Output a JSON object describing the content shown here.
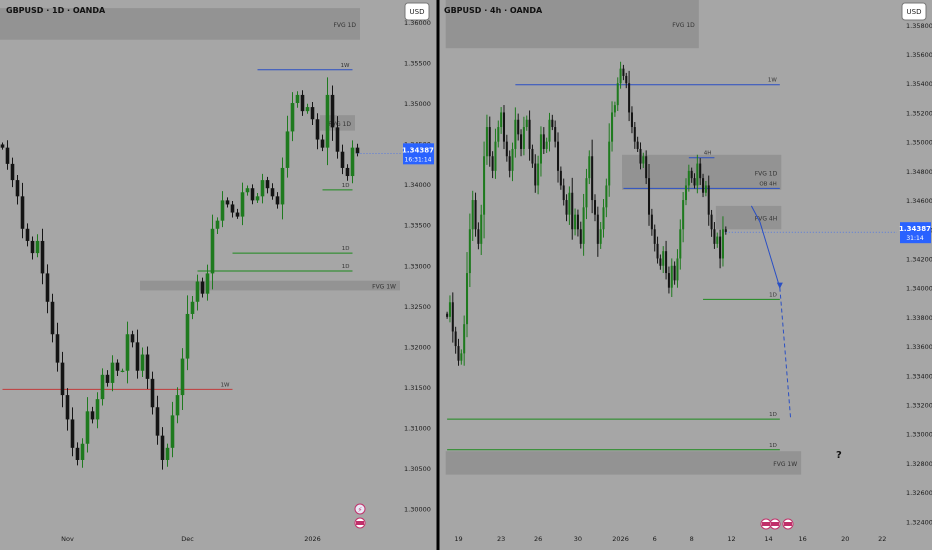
{
  "colors": {
    "background": "#a6a6a6",
    "bull": "#1e7a1e",
    "bear": "#141414",
    "zone": "#8c8c8c",
    "level_blue": "#2a4fc4",
    "level_green": "#1c8a1c",
    "level_red": "#c23b3b",
    "price_tag": "#2962ff",
    "divider": "#000000"
  },
  "chart_data": [
    {
      "type": "candlestick",
      "title": "GBPUSD · 1D · OANDA",
      "currency_button": "USD",
      "ylim": [
        1.297,
        1.3627
      ],
      "y_ticks": [
        "1.36000",
        "1.35500",
        "1.35000",
        "1.34500",
        "1.34000",
        "1.33500",
        "1.33000",
        "1.32500",
        "1.32000",
        "1.31500",
        "1.31000",
        "1.30500",
        "1.30000"
      ],
      "y_tick_values": [
        1.36,
        1.355,
        1.35,
        1.345,
        1.34,
        1.335,
        1.33,
        1.325,
        1.32,
        1.315,
        1.31,
        1.305,
        1.3
      ],
      "x_labels": [
        "Nov",
        "Dec",
        "2026"
      ],
      "x_label_bars": [
        13,
        37,
        62
      ],
      "last_price": "1.34387",
      "countdown": "16:31:14",
      "bar_count": 72,
      "closes": [
        1.3445,
        1.3425,
        1.3405,
        1.3385,
        1.3345,
        1.333,
        1.3315,
        1.333,
        1.329,
        1.3255,
        1.3215,
        1.318,
        1.314,
        1.311,
        1.3075,
        1.306,
        1.308,
        1.312,
        1.311,
        1.3135,
        1.3165,
        1.3155,
        1.318,
        1.317,
        1.317,
        1.3215,
        1.3205,
        1.317,
        1.319,
        1.316,
        1.3125,
        1.309,
        1.306,
        1.3075,
        1.3115,
        1.314,
        1.3185,
        1.324,
        1.3255,
        1.328,
        1.3265,
        1.329,
        1.3345,
        1.3355,
        1.338,
        1.3375,
        1.3365,
        1.336,
        1.339,
        1.3395,
        1.338,
        1.3385,
        1.3405,
        1.3395,
        1.3385,
        1.3375,
        1.342,
        1.3465,
        1.35,
        1.351,
        1.349,
        1.3495,
        1.348,
        1.3455,
        1.3445,
        1.351,
        1.347,
        1.344,
        1.342,
        1.341,
        1.3445,
        1.3438
      ],
      "zones": [
        {
          "label": "FVG 1D",
          "y_top": 1.3617,
          "y_bottom": 1.3578,
          "x_from": 0,
          "x_to": 71
        },
        {
          "label": "FVG 1D",
          "y_top": 1.3485,
          "y_bottom": 1.3466,
          "x_from": 64,
          "x_to": 70
        },
        {
          "label": "FVG 1W",
          "y_top": 1.3281,
          "y_bottom": 1.3269,
          "x_from": 28,
          "x_to": 80
        }
      ],
      "levels": [
        {
          "label": "1W",
          "value": 1.3541,
          "x_from": 51,
          "x_to": 70,
          "color": "level_blue"
        },
        {
          "label": "1D",
          "value": 1.3393,
          "x_from": 64,
          "x_to": 70,
          "color": "level_green"
        },
        {
          "label": "1D",
          "value": 1.3315,
          "x_from": 46,
          "x_to": 70,
          "color": "level_green"
        },
        {
          "label": "1D",
          "value": 1.3293,
          "x_from": 39,
          "x_to": 70,
          "color": "level_green"
        },
        {
          "label": "1W",
          "value": 1.3147,
          "x_from": 0,
          "x_to": 46,
          "color": "level_red"
        }
      ]
    },
    {
      "type": "candlestick",
      "title": "GBPUSD · 4h · OANDA",
      "currency_button": "USD",
      "ylim": [
        1.3232,
        1.3597
      ],
      "y_ticks": [
        "1.35800",
        "1.35600",
        "1.35400",
        "1.35200",
        "1.35000",
        "1.34800",
        "1.34600",
        "1.34400",
        "1.34200",
        "1.34000",
        "1.33800",
        "1.33600",
        "1.33400",
        "1.33200",
        "1.33000",
        "1.32800",
        "1.32600",
        "1.32400"
      ],
      "y_tick_values": [
        1.358,
        1.356,
        1.354,
        1.352,
        1.35,
        1.348,
        1.346,
        1.344,
        1.342,
        1.34,
        1.338,
        1.336,
        1.334,
        1.332,
        1.33,
        1.328,
        1.326,
        1.324
      ],
      "x_labels": [
        "19",
        "23",
        "26",
        "30",
        "2026",
        "6",
        "8",
        "12",
        "14",
        "16",
        "20",
        "22"
      ],
      "x_label_bars": [
        4,
        19,
        32,
        46,
        61,
        73,
        86,
        100,
        113,
        125,
        140,
        153
      ],
      "last_price": "1.34387",
      "countdown": "31:14",
      "bar_count": 120,
      "closes": [
        1.338,
        1.339,
        1.337,
        1.336,
        1.335,
        1.3355,
        1.3375,
        1.341,
        1.344,
        1.346,
        1.344,
        1.343,
        1.345,
        1.349,
        1.351,
        1.349,
        1.348,
        1.35,
        1.351,
        1.352,
        1.35,
        1.349,
        1.348,
        1.3495,
        1.3515,
        1.3505,
        1.3495,
        1.351,
        1.3515,
        1.3495,
        1.3485,
        1.347,
        1.3485,
        1.3505,
        1.3495,
        1.35,
        1.3515,
        1.351,
        1.35,
        1.348,
        1.347,
        1.346,
        1.345,
        1.3465,
        1.344,
        1.345,
        1.344,
        1.343,
        1.3455,
        1.3475,
        1.349,
        1.346,
        1.345,
        1.343,
        1.344,
        1.3455,
        1.347,
        1.35,
        1.352,
        1.3525,
        1.354,
        1.355,
        1.3545,
        1.354,
        1.352,
        1.351,
        1.35,
        1.3495,
        1.3485,
        1.349,
        1.3475,
        1.345,
        1.344,
        1.343,
        1.342,
        1.3415,
        1.3425,
        1.341,
        1.34,
        1.3415,
        1.3405,
        1.342,
        1.344,
        1.346,
        1.347,
        1.348,
        1.3475,
        1.347,
        1.3485,
        1.3475,
        1.3465,
        1.347,
        1.345,
        1.344,
        1.343,
        1.3435,
        1.342,
        1.344,
        1.3438
      ],
      "zones": [
        {
          "label": "FVG 1D",
          "y_top": 1.3597,
          "y_bottom": 1.3564,
          "x_from": 0,
          "x_to": 88
        },
        {
          "label": "FVG 1D",
          "y_top": 1.3491,
          "y_bottom": 1.3467,
          "x_from": 62,
          "x_to": 117
        },
        {
          "label": "FVG 4H",
          "y_top": 1.3456,
          "y_bottom": 1.344,
          "x_from": 95,
          "x_to": 117
        },
        {
          "label": "FVG 1W",
          "y_top": 1.3288,
          "y_bottom": 1.3272,
          "x_from": 0,
          "x_to": 124
        }
      ],
      "levels": [
        {
          "label": "1W",
          "value": 1.3539,
          "x_from": 24,
          "x_to": 117,
          "color": "level_blue"
        },
        {
          "label": "4H",
          "value": 1.3489,
          "x_from": 85,
          "x_to": 94,
          "color": "level_blue"
        },
        {
          "label": "OB 4H",
          "value": 1.3468,
          "x_from": 62,
          "x_to": 117,
          "color": "level_blue"
        },
        {
          "label": "1D",
          "value": 1.3392,
          "x_from": 90,
          "x_to": 117,
          "color": "level_green"
        },
        {
          "label": "1D",
          "value": 1.331,
          "x_from": 0,
          "x_to": 117,
          "color": "level_green"
        },
        {
          "label": "1D",
          "value": 1.3289,
          "x_from": 0,
          "x_to": 117,
          "color": "level_green"
        }
      ],
      "projection": {
        "path": [
          [
            107,
            1.3456
          ],
          [
            110,
            1.3445
          ],
          [
            117,
            1.34
          ]
        ],
        "dashed_to": [
          [
            117,
            1.34
          ],
          [
            118,
            1.331
          ]
        ],
        "question_mark": "?"
      }
    }
  ]
}
